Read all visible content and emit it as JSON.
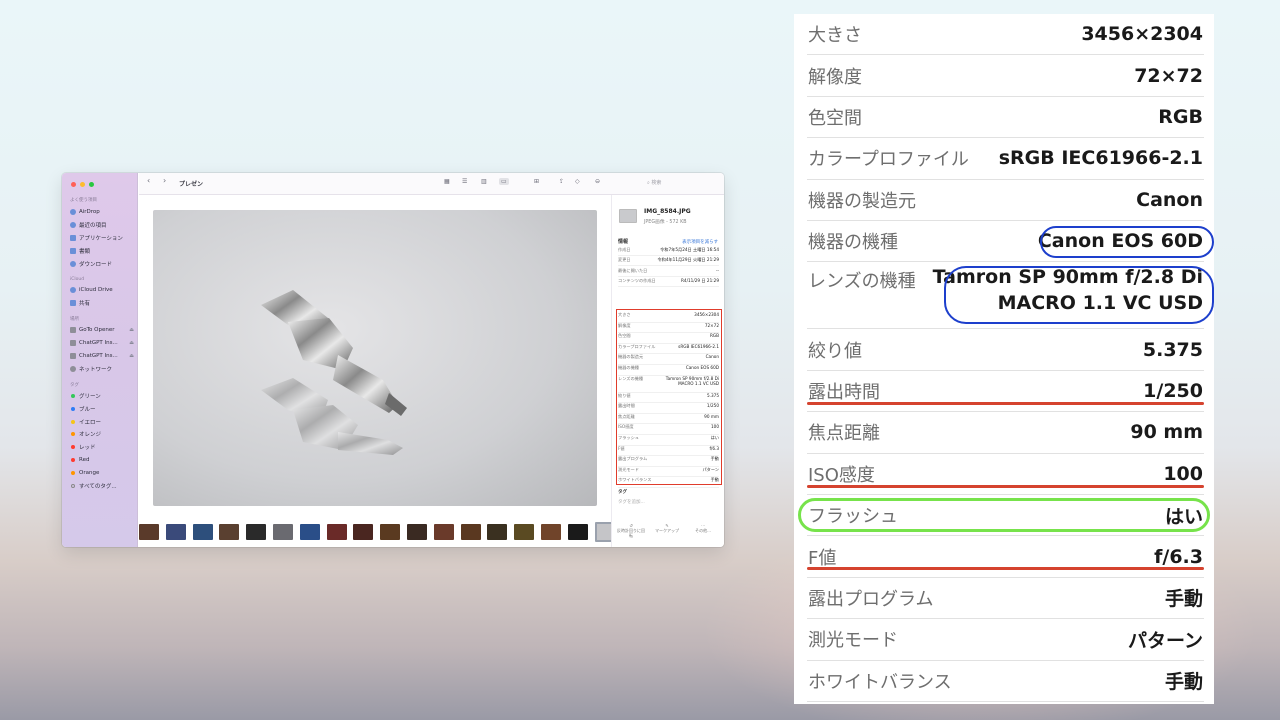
{
  "finder": {
    "toolbar": {
      "title": "プレゼン",
      "search_placeholder": "検索",
      "back": "‹",
      "forward": "›"
    },
    "sidebar": {
      "favorites_label": "よく使う項目",
      "favorites": [
        "AirDrop",
        "最近の項目",
        "アプリケーション",
        "書類",
        "ダウンロード"
      ],
      "icloud_label": "iCloud",
      "icloud": [
        "iCloud Drive",
        "共有"
      ],
      "locations_label": "場所",
      "locations": [
        "GoTo Opener",
        "ChatGPT Ins...",
        "ChatGPT Ins...",
        "ネットワーク"
      ],
      "tags_label": "タグ",
      "tags": [
        {
          "label": "グリーン",
          "color": "#34c759"
        },
        {
          "label": "ブルー",
          "color": "#2f7cf6"
        },
        {
          "label": "イエロー",
          "color": "#f5c518"
        },
        {
          "label": "オレンジ",
          "color": "#ff9500"
        },
        {
          "label": "レッド",
          "color": "#ff3b30"
        },
        {
          "label": "Red",
          "color": "#ff3b30"
        },
        {
          "label": "Orange",
          "color": "#ff9500"
        },
        {
          "label": "すべてのタグ...",
          "color": ""
        }
      ]
    },
    "panel": {
      "filename": "IMG_8584.JPG",
      "fileinfo": "JPEG画像 - 572 KB",
      "info_label": "情報",
      "show_less": "表示項目を減らす",
      "dates": [
        {
          "k": "作成日",
          "v": "令和7年5月24日 土曜日 16:54"
        },
        {
          "k": "変更日",
          "v": "令和4年11月29日 火曜日 21:29"
        },
        {
          "k": "最後に開いた日",
          "v": "--"
        },
        {
          "k": "コンテンツの作成日",
          "v": "R4/11/29 日 21:29"
        }
      ],
      "tags_label": "タグ",
      "tags_placeholder": "タグを追加...",
      "actions": [
        "反時計回りに回転",
        "マークアップ",
        "その他..."
      ]
    }
  },
  "metadata": [
    {
      "k": "大きさ",
      "v": "3456×2304"
    },
    {
      "k": "解像度",
      "v": "72×72"
    },
    {
      "k": "色空間",
      "v": "RGB"
    },
    {
      "k": "カラープロファイル",
      "v": "sRGB IEC61966-2.1"
    },
    {
      "k": "機器の製造元",
      "v": "Canon"
    },
    {
      "k": "機器の機種",
      "v": "Canon EOS 60D"
    },
    {
      "k": "レンズの機種",
      "v": "Tamron SP 90mm f/2.8 Di MACRO 1.1 VC USD",
      "v1": "Tamron SP 90mm f/2.8 Di",
      "v2": "MACRO 1.1 VC USD"
    },
    {
      "k": "絞り値",
      "v": "5.375"
    },
    {
      "k": "露出時間",
      "v": "1/250"
    },
    {
      "k": "焦点距離",
      "v": "90 mm"
    },
    {
      "k": "ISO感度",
      "v": "100"
    },
    {
      "k": "フラッシュ",
      "v": "はい"
    },
    {
      "k": "F値",
      "v": "f/6.3"
    },
    {
      "k": "露出プログラム",
      "v": "手動"
    },
    {
      "k": "測光モード",
      "v": "パターン"
    },
    {
      "k": "ホワイトバランス",
      "v": "手動"
    }
  ],
  "colors": {
    "red_highlight": "#d5432f",
    "blue_highlight": "#1d3fcc",
    "green_highlight": "#77e34b",
    "sidebar": "#dfc9ea"
  }
}
